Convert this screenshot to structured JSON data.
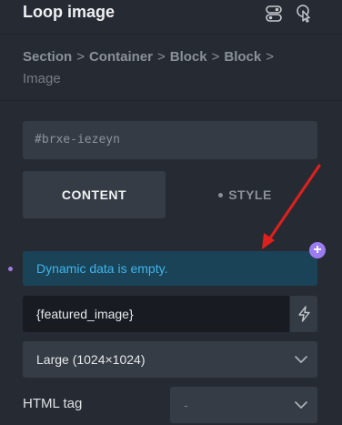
{
  "header": {
    "title": "Loop image",
    "icons": [
      "toggles-icon",
      "pointer-icon"
    ]
  },
  "breadcrumb": {
    "items": [
      "Section",
      "Container",
      "Block",
      "Block"
    ],
    "separator": ">",
    "current": "Image"
  },
  "element_id": "#brxe-iezeyn",
  "tabs": {
    "content_label": "CONTENT",
    "style_label": "STYLE"
  },
  "notice": {
    "text": "Dynamic data is empty."
  },
  "dynamic_field": {
    "value": "{featured_image}",
    "icon": "bolt-icon"
  },
  "size_select": {
    "value": "Large (1024×1024)"
  },
  "html_tag": {
    "label": "HTML tag",
    "value": "-"
  },
  "colors": {
    "background": "#262b33",
    "notice_bg": "#1a4358",
    "notice_text": "#3fb5ea",
    "accent_purple": "#9b7bf0",
    "annotation_arrow": "#e0201c"
  }
}
